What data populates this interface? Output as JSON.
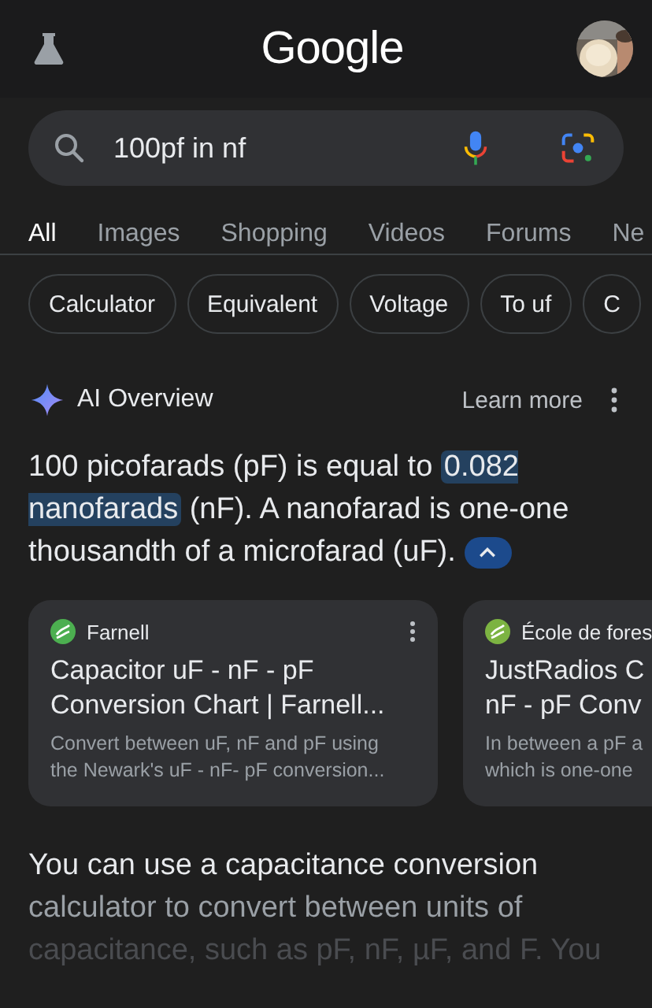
{
  "header": {
    "logo": "Google"
  },
  "search": {
    "value": "100pf in nf"
  },
  "tabs": [
    {
      "label": "All",
      "selected": true
    },
    {
      "label": "Images",
      "selected": false
    },
    {
      "label": "Shopping",
      "selected": false
    },
    {
      "label": "Videos",
      "selected": false
    },
    {
      "label": "Forums",
      "selected": false
    },
    {
      "label": "Ne",
      "selected": false
    }
  ],
  "chips": [
    "Calculator",
    "Equivalent",
    "Voltage",
    "To uf",
    "C"
  ],
  "ai_overview": {
    "title": "AI Overview",
    "learn_more": "Learn more",
    "answer": [
      {
        "text": "100 picofarads (pF) is equal to ",
        "highlighted": false
      },
      {
        "text": "0.082 nanofarads",
        "highlighted": true
      },
      {
        "text": " (nF). A nanofarad is one-one thousandth of a microfarad (uF).",
        "highlighted": false
      }
    ],
    "expanded": true,
    "sources": [
      {
        "site": "Farnell",
        "color": "#4caf50",
        "title_lines": [
          "Capacitor uF - nF - pF",
          "Conversion Chart | Farnell..."
        ],
        "snippet_lines": [
          "Convert between uF, nF and pF using",
          "the Newark's uF - nF- pF conversion..."
        ]
      },
      {
        "site": "École de fores",
        "color": "#7cb342",
        "title_lines": [
          "JustRadios C",
          "nF - pF Conv"
        ],
        "snippet_lines": [
          "In between a pF a",
          "which is one-one"
        ]
      }
    ],
    "more_text": "You can use a capacitance conversion calculator to convert between units of capacitance, such as pF, nF, µF, and F. You"
  }
}
